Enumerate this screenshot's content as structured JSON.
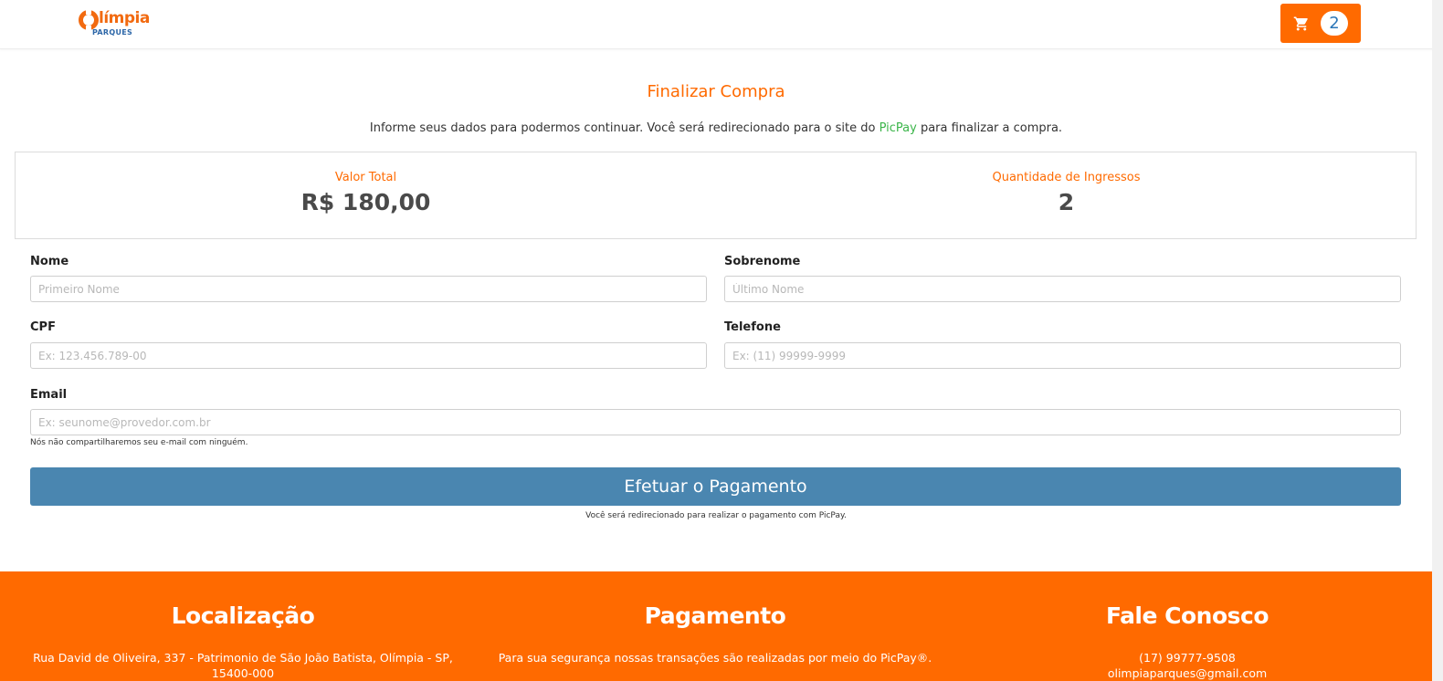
{
  "header": {
    "logo_name": "límpia",
    "logo_sub": "PARQUES",
    "cart_count": "2",
    "colors": {
      "brand_orange": "#ff6a00",
      "badge_text": "#2b76b8"
    }
  },
  "checkout": {
    "title": "Finalizar Compra",
    "intro_before": "Informe seus dados para podermos continuar. Você será redirecionado para o site do ",
    "intro_link": "PicPay",
    "intro_after": " para finalizar a compra.",
    "summary": {
      "total_label": "Valor Total",
      "total_value": "R$ 180,00",
      "qty_label": "Quantidade de Ingressos",
      "qty_value": "2"
    },
    "form": {
      "nome_label": "Nome",
      "nome_placeholder": "Primeiro Nome",
      "sobrenome_label": "Sobrenome",
      "sobrenome_placeholder": "Último Nome",
      "cpf_label": "CPF",
      "cpf_placeholder": "Ex: 123.456.789-00",
      "telefone_label": "Telefone",
      "telefone_placeholder": "Ex: (11) 99999-9999",
      "email_label": "Email",
      "email_placeholder": "Ex: seunome@provedor.com.br",
      "email_help": "Nós não compartilharemos seu e-mail com ninguém."
    },
    "pay_button": "Efetuar o Pagamento",
    "pay_note": "Você será redirecionado para realizar o pagamento com PicPay."
  },
  "footer": {
    "location_title": "Localização",
    "location_line1": "Rua David de Oliveira, 337 - Patrimonio de São João Batista, Olímpia - SP,",
    "location_line2": "15400-000",
    "payment_title": "Pagamento",
    "payment_text": "Para sua segurança nossas transações são realizadas por meio do PicPay®.",
    "contact_title": "Fale Conosco",
    "contact_phone": "(17) 99777-9508",
    "contact_email": "olimpiaparques@gmail.com"
  }
}
